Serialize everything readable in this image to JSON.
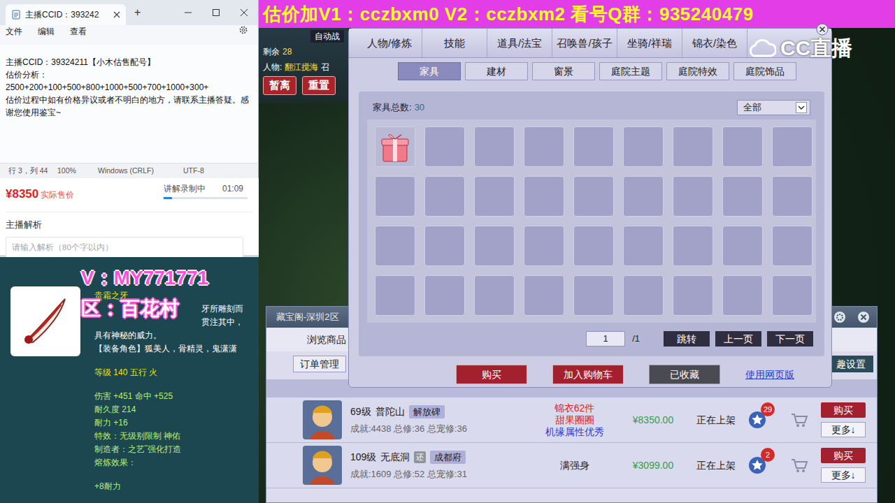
{
  "stream_banner": {
    "text": "估价加V1：cczbxm0    V2：cczbxm2   看号Q群：935240479"
  },
  "platform_logo": "CC直播",
  "notepad": {
    "tab_title": "主播CCID：393242",
    "new_tab": "+",
    "menu": [
      "文件",
      "编辑",
      "查看"
    ],
    "lines": [
      "主播CCID：39324211【小木估售配号】",
      "估价分析：",
      "2500+200+100+500+800+1000+500+700+1000+300+",
      "估价过程中如有价格异议或者不明白的地方，请联系主播答疑。感谢您使用鉴宝~"
    ],
    "status": [
      "行 3，列 44",
      "100%",
      "Windows (CRLF)",
      "UTF-8"
    ]
  },
  "sale_panel": {
    "price": "¥8350",
    "price_label": "实际售价",
    "recording": "讲解录制中",
    "time": "01:09",
    "level": 0.1,
    "section": "主播解析",
    "placeholder": "请输入解析（80个字以内）"
  },
  "item_card": {
    "overlay": [
      {
        "text": "V：MY771771",
        "color": "#ff4fd8"
      },
      {
        "text": "区：百花村",
        "color": "#ffffff"
      }
    ],
    "lines": [
      {
        "text": "贵霜之牙",
        "color": "#f2e600",
        "kind": "line"
      },
      {
        "text": "牙所雕刻而",
        "color": "#ffffff",
        "kind": "fragment"
      },
      {
        "text": "贯注其中，",
        "color": "#ffffff",
        "kind": "fragment"
      },
      {
        "text": "具有神秘的威力。",
        "color": "#ffffff",
        "kind": "line"
      },
      {
        "text": "【装备角色】狐美人，骨精灵，鬼潇潇",
        "color": "#ffffff",
        "kind": "line"
      },
      {
        "text": "等级 140 五行 火",
        "color": "#f2e600",
        "kind": "spaced"
      },
      {
        "text": "伤害 +451 命中 +525",
        "color": "#b8f070",
        "kind": "spaced"
      },
      {
        "text": "耐久度 214",
        "color": "#b8f070",
        "kind": "line"
      },
      {
        "text": "耐力 +16",
        "color": "#b8f070",
        "kind": "line"
      },
      {
        "text": "特效：无级别限制 神佑",
        "color": "#b8f070",
        "kind": "line"
      },
      {
        "text": "制造者：之艺ˇ强化打造",
        "color": "#b8f070",
        "kind": "line"
      },
      {
        "text": "熔炼效果：",
        "color": "#b8f070",
        "kind": "line"
      },
      {
        "text": "+8耐力",
        "color": "#b8f070",
        "kind": "spaced"
      }
    ]
  },
  "game_hud": {
    "auto_label": "自动战",
    "remain_label": "剩余",
    "remain_value": "28",
    "player_label": "人物:",
    "player_name": "翻江搅海",
    "player_extra": "召",
    "buttons": [
      "暂离",
      "重置"
    ]
  },
  "inventory_dialog": {
    "tabs": [
      {
        "label": "人物/修炼",
        "selected": false
      },
      {
        "label": "技能",
        "selected": false
      },
      {
        "label": "道具/法宝",
        "selected": false
      },
      {
        "label": "召唤兽/孩子",
        "selected": false
      },
      {
        "label": "坐骑/祥瑞",
        "selected": false
      },
      {
        "label": "锦衣/染色",
        "selected": false
      }
    ],
    "subtabs": [
      {
        "label": "家具",
        "selected": true
      },
      {
        "label": "建材",
        "selected": false
      },
      {
        "label": "窗景",
        "selected": false
      },
      {
        "label": "庭院主题",
        "selected": false
      },
      {
        "label": "庭院特效",
        "selected": false
      },
      {
        "label": "庭院饰品",
        "selected": false
      }
    ],
    "count_label": "家具总数:",
    "count": "30",
    "filter": "全部",
    "slots": [
      {
        "filled": true
      },
      {
        "filled": false
      },
      {
        "filled": false
      },
      {
        "filled": false
      },
      {
        "filled": false
      },
      {
        "filled": false
      },
      {
        "filled": false
      },
      {
        "filled": false
      },
      {
        "filled": false
      },
      {
        "filled": false
      },
      {
        "filled": false
      },
      {
        "filled": false
      },
      {
        "filled": false
      },
      {
        "filled": false
      },
      {
        "filled": false
      },
      {
        "filled": false
      },
      {
        "filled": false
      },
      {
        "filled": false
      },
      {
        "filled": false
      },
      {
        "filled": false
      },
      {
        "filled": false
      },
      {
        "filled": false
      },
      {
        "filled": false
      },
      {
        "filled": false
      },
      {
        "filled": false
      },
      {
        "filled": false
      },
      {
        "filled": false
      },
      {
        "filled": false
      },
      {
        "filled": false
      },
      {
        "filled": false
      },
      {
        "filled": false
      },
      {
        "filled": false
      },
      {
        "filled": false
      },
      {
        "filled": false
      },
      {
        "filled": false
      },
      {
        "filled": false
      }
    ],
    "page": "1",
    "page_total": "/1",
    "page_buttons": [
      "跳转",
      "上一页",
      "下一页"
    ],
    "actions": [
      {
        "label": "购买",
        "kind": "primary"
      },
      {
        "label": "加入购物车",
        "kind": "primary"
      },
      {
        "label": "已收藏",
        "kind": "muted"
      },
      {
        "label": "使用网页版",
        "kind": "link"
      }
    ]
  },
  "market_window": {
    "title": "藏宝阁-深圳2区",
    "browse_tab": "浏览商品",
    "orders_button": "订单管理",
    "settings_button": "趣设置",
    "rows": [
      {
        "grade": "69级",
        "school": "普陀山",
        "tags": [
          {
            "text": "解放碑",
            "kind": "server"
          }
        ],
        "stats": "成就:4438 总修:36 总宠修:36",
        "highlights": [
          {
            "text": "锦衣62件",
            "color": "#e02424"
          },
          {
            "text": "甜果圈圈",
            "color": "#e02424"
          },
          {
            "text": "机缘属性优秀",
            "color": "#2a3fd6"
          }
        ],
        "price": "¥8350.00",
        "status": "正在上架",
        "favorites": "29",
        "buy": "购买",
        "more": "更多↓"
      },
      {
        "grade": "109级",
        "school": "无底洞",
        "tags": [
          {
            "text": "还",
            "kind": "mark"
          },
          {
            "text": "成都府",
            "kind": "server"
          }
        ],
        "stats": "成就:1609 总修:52 总宠修:31",
        "highlights": [
          {
            "text": "满强身",
            "color": "#222222"
          }
        ],
        "price": "¥3099.00",
        "status": "正在上架",
        "favorites": "2",
        "buy": "购买",
        "more": "更多↓"
      }
    ]
  }
}
